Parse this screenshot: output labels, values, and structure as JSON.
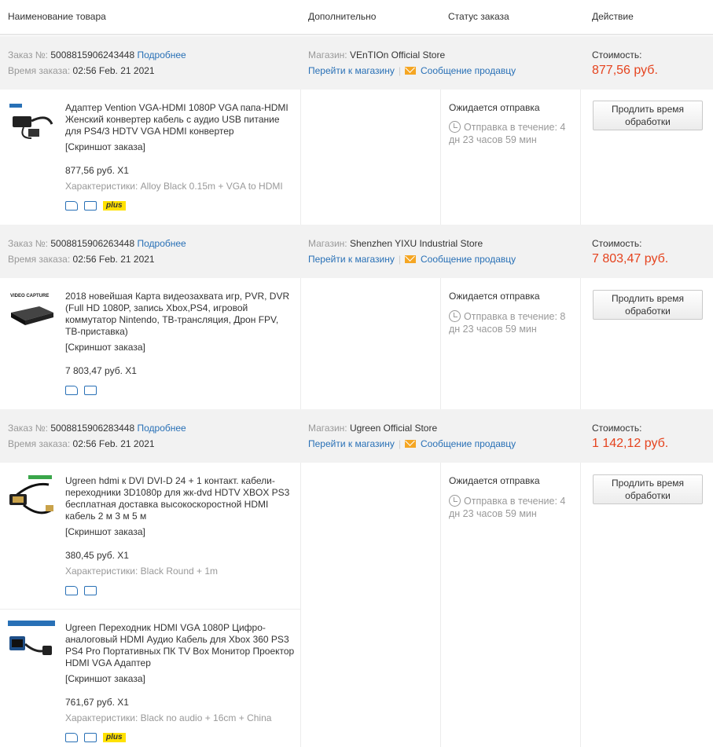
{
  "columns": [
    "Наименование товара",
    "Дополнительно",
    "Статус заказа",
    "Действие"
  ],
  "labels": {
    "order_no": "Заказ №:",
    "details": "Подробнее",
    "order_time": "Время заказа:",
    "store": "Магазин:",
    "go_store": "Перейти к магазину",
    "separator": "|",
    "message": "Сообщение продавцу",
    "cost": "Стоимость:",
    "snapshot": "[Скриншот заказа]",
    "specs": "Характеристики:",
    "status": "Ожидается отправка",
    "extend": "Продлить время обработки",
    "plus": "plus"
  },
  "orders": [
    {
      "number": "5008815906243448",
      "time": "02:56 Feb. 21 2021",
      "store": "VEnTIOn Official Store",
      "cost": "877,56 руб.",
      "items": [
        {
          "title": "Адаптер Vention VGA-HDMI 1080P VGA папа-HDMI Женский конвертер кабель с аудио USB питание для PS4/3 HDTV VGA HDMI конвертер",
          "price": "877,56 руб. X1",
          "specs": "Alloy Black 0.15m + VGA to HDMI",
          "plus": true,
          "shipping": "Отправка в течение: 4 дн 23 часов 59 мин"
        }
      ]
    },
    {
      "number": "5008815906263448",
      "time": "02:56 Feb. 21 2021",
      "store": "Shenzhen YIXU Industrial Store",
      "cost": "7 803,47 руб.",
      "items": [
        {
          "title": "2018 новейшая Карта видеозахвата игр, PVR, DVR (Full HD 1080P, запись Xbox,PS4, игровой коммутатор Nintendo, ТВ-трансляция, Дрон FPV, ТВ-приставка)",
          "price": "7 803,47 руб. X1",
          "specs": "",
          "plus": false,
          "shipping": "Отправка в течение: 8 дн 23 часов 59 мин",
          "thumb_text": "VIDEO CAPTURE"
        }
      ]
    },
    {
      "number": "5008815906283448",
      "time": "02:56 Feb. 21 2021",
      "store": "Ugreen Official Store",
      "cost": "1 142,12 руб.",
      "items": [
        {
          "title": "Ugreen hdmi к DVI DVI-D 24 + 1 контакт. кабели-переходники 3D1080p для жк-dvd HDTV XBOX PS3 бесплатная доставка высокоскоростной HDMI кабель 2 м 3 м 5 м",
          "price": "380,45 руб. X1",
          "specs": "Black Round + 1m",
          "plus": false,
          "shipping": "Отправка в течение: 4 дн 23 часов 59 мин"
        },
        {
          "title": "Ugreen Переходник HDMI VGA 1080P Цифро-аналоговый HDMI Аудио Кабель для Xbox 360 PS3 PS4 Pro Портативных ПК TV Box Монитор Проектор HDMI VGA Адаптер",
          "price": "761,67 руб. X1",
          "specs": "Black no audio + 16cm + China",
          "plus": true
        }
      ]
    }
  ],
  "colors": {
    "link": "#2870b6",
    "price": "#e5431e",
    "header_bg": "#f2f2f2",
    "plus_badge": "#ffe100"
  },
  "icons": [
    "truck-icon",
    "return-icon",
    "clock-icon",
    "mail-icon"
  ]
}
